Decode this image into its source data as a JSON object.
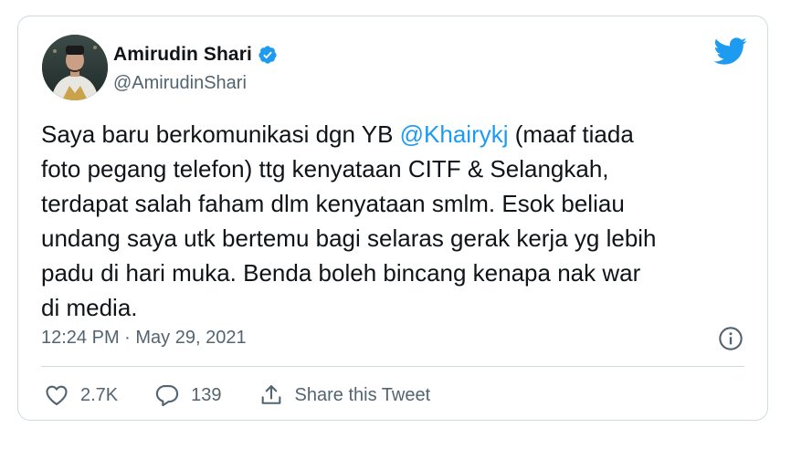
{
  "author": {
    "name": "Amirudin Shari",
    "handle": "@AmirudinShari",
    "verified": true,
    "avatar_icon": "profile-photo"
  },
  "tweet": {
    "text_before_mention": "Saya baru berkomunikasi dgn YB ",
    "mention": "@Khairykj",
    "text_after_mention": " (maaf tiada\nfoto pegang telefon) ttg kenyataan CITF & Selangkah,\nterdapat salah faham dlm kenyataan smlm. Esok beliau\nundang saya utk bertemu bagi selaras gerak kerja yg lebih\npadu di hari muka. Benda boleh bincang kenapa nak war\ndi media.",
    "timestamp": "12:24 PM · May 29, 2021"
  },
  "actions": {
    "likes": "2.7K",
    "replies": "139",
    "share_label": "Share this Tweet"
  },
  "colors": {
    "accent": "#1d9bf0",
    "text": "#0f1419",
    "secondary": "#536471",
    "border": "#cfd9de"
  }
}
